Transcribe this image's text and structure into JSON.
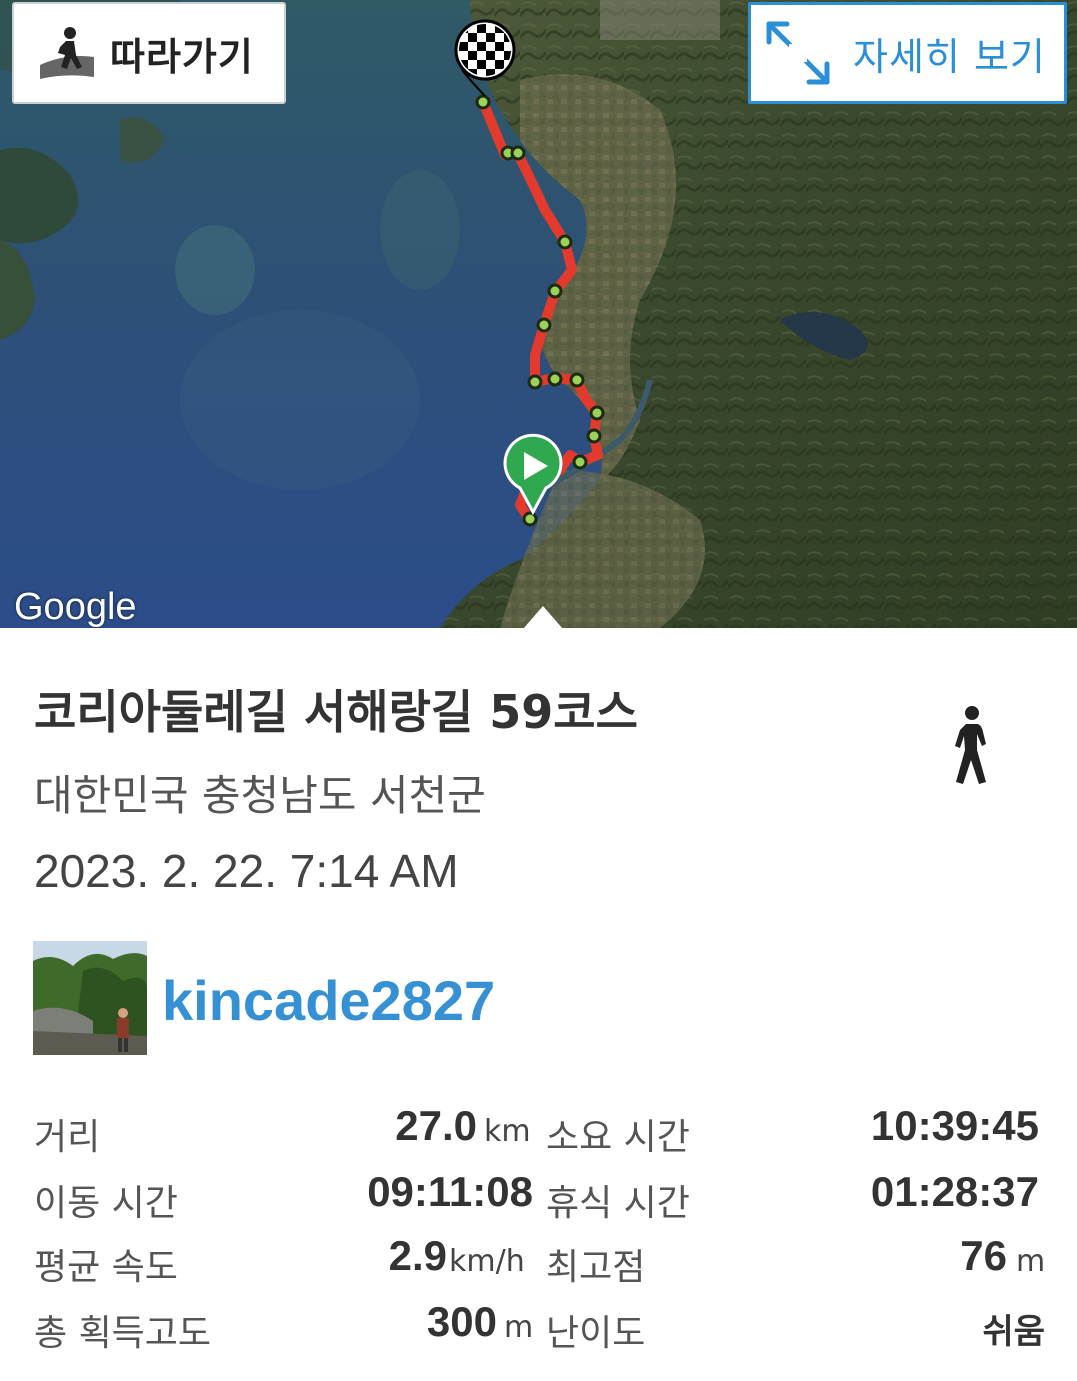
{
  "map": {
    "follow_button": {
      "label": "따라가기",
      "icon": "walker-follow-icon"
    },
    "detail_button": {
      "label": "자세히 보기",
      "icon": "expand-arrows-icon"
    },
    "attribution": "Google",
    "markers": {
      "start": "start-play-pin-icon",
      "finish": "checkered-finish-flag-icon"
    },
    "route_color": "#e23b2e",
    "waypoint_color": "#9bd35a"
  },
  "trail": {
    "title": "코리아둘레길 서해랑길 59코스",
    "activity_icon": "walking-person-icon",
    "location": "대한민국 충청남도 서천군",
    "datetime": "2023. 2. 22. 7:14 AM"
  },
  "user": {
    "name": "kincade2827",
    "avatar": "user-avatar-photo",
    "color": "#3591d3"
  },
  "stats": {
    "distance": {
      "label": "거리",
      "value": "27.0",
      "unit": "km"
    },
    "total_time": {
      "label": "소요 시간",
      "value": "10:39:45"
    },
    "moving_time": {
      "label": "이동 시간",
      "value": "09:11:08"
    },
    "rest_time": {
      "label": "휴식 시간",
      "value": "01:28:37"
    },
    "avg_speed": {
      "label": "평균 속도",
      "value": "2.9",
      "unit": "km/h"
    },
    "max_elevation": {
      "label": "최고점",
      "value": "76",
      "unit": "m"
    },
    "total_ascent": {
      "label": "총 획득고도",
      "value": "300",
      "unit": "m"
    },
    "difficulty": {
      "label": "난이도",
      "value": "쉬움"
    }
  }
}
